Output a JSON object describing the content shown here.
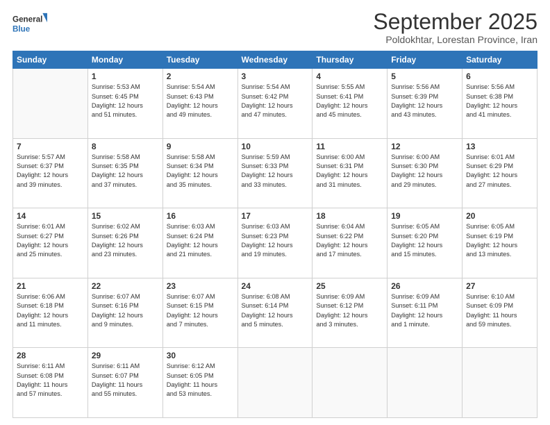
{
  "logo": {
    "line1": "General",
    "line2": "Blue"
  },
  "title": "September 2025",
  "subtitle": "Poldokhtar, Lorestan Province, Iran",
  "days_of_week": [
    "Sunday",
    "Monday",
    "Tuesday",
    "Wednesday",
    "Thursday",
    "Friday",
    "Saturday"
  ],
  "weeks": [
    [
      {
        "day": "",
        "info": ""
      },
      {
        "day": "1",
        "info": "Sunrise: 5:53 AM\nSunset: 6:45 PM\nDaylight: 12 hours\nand 51 minutes."
      },
      {
        "day": "2",
        "info": "Sunrise: 5:54 AM\nSunset: 6:43 PM\nDaylight: 12 hours\nand 49 minutes."
      },
      {
        "day": "3",
        "info": "Sunrise: 5:54 AM\nSunset: 6:42 PM\nDaylight: 12 hours\nand 47 minutes."
      },
      {
        "day": "4",
        "info": "Sunrise: 5:55 AM\nSunset: 6:41 PM\nDaylight: 12 hours\nand 45 minutes."
      },
      {
        "day": "5",
        "info": "Sunrise: 5:56 AM\nSunset: 6:39 PM\nDaylight: 12 hours\nand 43 minutes."
      },
      {
        "day": "6",
        "info": "Sunrise: 5:56 AM\nSunset: 6:38 PM\nDaylight: 12 hours\nand 41 minutes."
      }
    ],
    [
      {
        "day": "7",
        "info": "Sunrise: 5:57 AM\nSunset: 6:37 PM\nDaylight: 12 hours\nand 39 minutes."
      },
      {
        "day": "8",
        "info": "Sunrise: 5:58 AM\nSunset: 6:35 PM\nDaylight: 12 hours\nand 37 minutes."
      },
      {
        "day": "9",
        "info": "Sunrise: 5:58 AM\nSunset: 6:34 PM\nDaylight: 12 hours\nand 35 minutes."
      },
      {
        "day": "10",
        "info": "Sunrise: 5:59 AM\nSunset: 6:33 PM\nDaylight: 12 hours\nand 33 minutes."
      },
      {
        "day": "11",
        "info": "Sunrise: 6:00 AM\nSunset: 6:31 PM\nDaylight: 12 hours\nand 31 minutes."
      },
      {
        "day": "12",
        "info": "Sunrise: 6:00 AM\nSunset: 6:30 PM\nDaylight: 12 hours\nand 29 minutes."
      },
      {
        "day": "13",
        "info": "Sunrise: 6:01 AM\nSunset: 6:29 PM\nDaylight: 12 hours\nand 27 minutes."
      }
    ],
    [
      {
        "day": "14",
        "info": "Sunrise: 6:01 AM\nSunset: 6:27 PM\nDaylight: 12 hours\nand 25 minutes."
      },
      {
        "day": "15",
        "info": "Sunrise: 6:02 AM\nSunset: 6:26 PM\nDaylight: 12 hours\nand 23 minutes."
      },
      {
        "day": "16",
        "info": "Sunrise: 6:03 AM\nSunset: 6:24 PM\nDaylight: 12 hours\nand 21 minutes."
      },
      {
        "day": "17",
        "info": "Sunrise: 6:03 AM\nSunset: 6:23 PM\nDaylight: 12 hours\nand 19 minutes."
      },
      {
        "day": "18",
        "info": "Sunrise: 6:04 AM\nSunset: 6:22 PM\nDaylight: 12 hours\nand 17 minutes."
      },
      {
        "day": "19",
        "info": "Sunrise: 6:05 AM\nSunset: 6:20 PM\nDaylight: 12 hours\nand 15 minutes."
      },
      {
        "day": "20",
        "info": "Sunrise: 6:05 AM\nSunset: 6:19 PM\nDaylight: 12 hours\nand 13 minutes."
      }
    ],
    [
      {
        "day": "21",
        "info": "Sunrise: 6:06 AM\nSunset: 6:18 PM\nDaylight: 12 hours\nand 11 minutes."
      },
      {
        "day": "22",
        "info": "Sunrise: 6:07 AM\nSunset: 6:16 PM\nDaylight: 12 hours\nand 9 minutes."
      },
      {
        "day": "23",
        "info": "Sunrise: 6:07 AM\nSunset: 6:15 PM\nDaylight: 12 hours\nand 7 minutes."
      },
      {
        "day": "24",
        "info": "Sunrise: 6:08 AM\nSunset: 6:14 PM\nDaylight: 12 hours\nand 5 minutes."
      },
      {
        "day": "25",
        "info": "Sunrise: 6:09 AM\nSunset: 6:12 PM\nDaylight: 12 hours\nand 3 minutes."
      },
      {
        "day": "26",
        "info": "Sunrise: 6:09 AM\nSunset: 6:11 PM\nDaylight: 12 hours\nand 1 minute."
      },
      {
        "day": "27",
        "info": "Sunrise: 6:10 AM\nSunset: 6:09 PM\nDaylight: 11 hours\nand 59 minutes."
      }
    ],
    [
      {
        "day": "28",
        "info": "Sunrise: 6:11 AM\nSunset: 6:08 PM\nDaylight: 11 hours\nand 57 minutes."
      },
      {
        "day": "29",
        "info": "Sunrise: 6:11 AM\nSunset: 6:07 PM\nDaylight: 11 hours\nand 55 minutes."
      },
      {
        "day": "30",
        "info": "Sunrise: 6:12 AM\nSunset: 6:05 PM\nDaylight: 11 hours\nand 53 minutes."
      },
      {
        "day": "",
        "info": ""
      },
      {
        "day": "",
        "info": ""
      },
      {
        "day": "",
        "info": ""
      },
      {
        "day": "",
        "info": ""
      }
    ]
  ]
}
